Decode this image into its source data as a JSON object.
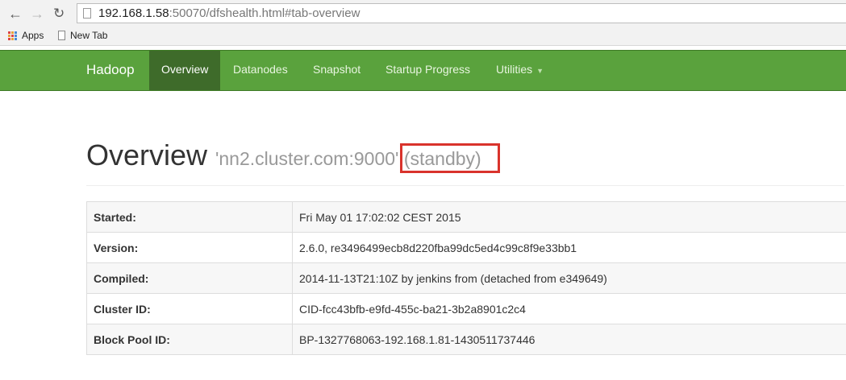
{
  "browser": {
    "url_host": "192.168.1.58",
    "url_rest": ":50070/dfshealth.html#tab-overview",
    "bookmarks": [
      {
        "label": "Apps",
        "icon": "apps-grid-icon"
      },
      {
        "label": "New Tab",
        "icon": "page-icon"
      }
    ]
  },
  "navbar": {
    "brand": "Hadoop",
    "items": [
      {
        "label": "Overview",
        "active": true
      },
      {
        "label": "Datanodes",
        "active": false
      },
      {
        "label": "Snapshot",
        "active": false
      },
      {
        "label": "Startup Progress",
        "active": false
      },
      {
        "label": "Utilities",
        "active": false,
        "dropdown": true
      }
    ],
    "color": "#5aa23d",
    "active_color": "#3e6b2a"
  },
  "header": {
    "title": "Overview",
    "host": "'nn2.cluster.com:9000'",
    "state": "(standby)",
    "highlight_color": "#d9332c"
  },
  "info_table": [
    {
      "key": "Started:",
      "value": "Fri May 01 17:02:02 CEST 2015"
    },
    {
      "key": "Version:",
      "value": "2.6.0, re3496499ecb8d220fba99dc5ed4c99c8f9e33bb1"
    },
    {
      "key": "Compiled:",
      "value": "2014-11-13T21:10Z by jenkins from (detached from e349649)"
    },
    {
      "key": "Cluster ID:",
      "value": "CID-fcc43bfb-e9fd-455c-ba21-3b2a8901c2c4"
    },
    {
      "key": "Block Pool ID:",
      "value": "BP-1327768063-192.168.1.81-1430511737446"
    }
  ]
}
